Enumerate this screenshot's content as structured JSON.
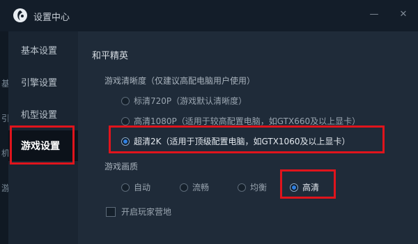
{
  "window": {
    "title": "设置中心",
    "minimize_glyph": "—",
    "close_glyph": "✕",
    "edge_chars": [
      "基",
      "引",
      "机",
      "游"
    ]
  },
  "sidebar": {
    "items": [
      {
        "label": "基本设置",
        "active": false
      },
      {
        "label": "引擎设置",
        "active": false
      },
      {
        "label": "机型设置",
        "active": false
      },
      {
        "label": "游戏设置",
        "active": true
      }
    ]
  },
  "main": {
    "game_title": "和平精英",
    "resolution": {
      "heading": "游戏清晰度（仅建议高配电脑用户使用）",
      "options": [
        {
          "label": "标清720P（游戏默认清晰度）",
          "checked": false
        },
        {
          "label": "高清1080P（适用于较高配置电脑，如GTX660及以上显卡）",
          "checked": false
        },
        {
          "label": "超清2K（适用于顶级配置电脑，如GTX1060及以上显卡）",
          "checked": true
        }
      ]
    },
    "quality": {
      "heading": "游戏画质",
      "options": [
        {
          "label": "自动",
          "checked": false
        },
        {
          "label": "流畅",
          "checked": false
        },
        {
          "label": "均衡",
          "checked": false
        },
        {
          "label": "高清",
          "checked": true
        }
      ]
    },
    "player_camp": {
      "label": "开启玩家营地",
      "checked": false
    }
  },
  "colors": {
    "highlight_border": "#e0141c",
    "radio_selected": "#2f7fe0",
    "background": "#1f2b39"
  }
}
